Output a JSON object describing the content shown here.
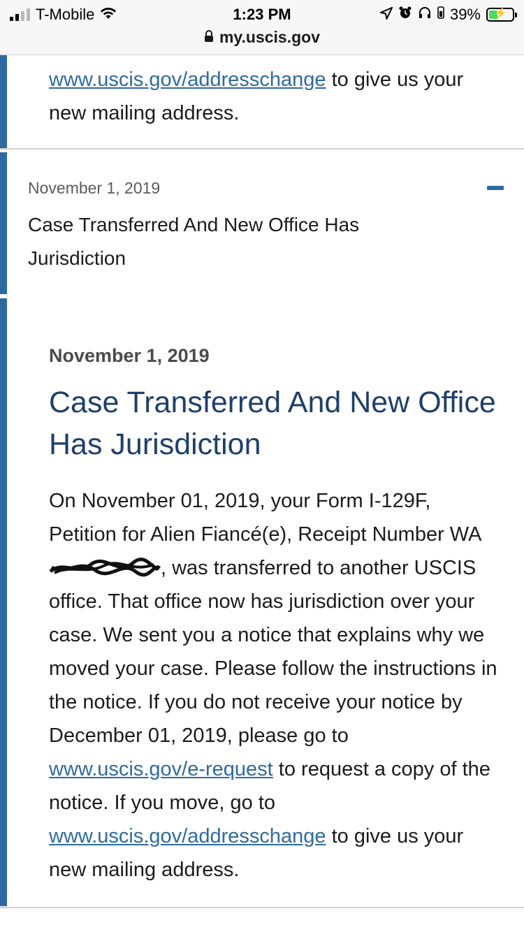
{
  "status_bar": {
    "carrier": "T-Mobile",
    "time": "1:23 PM",
    "battery": "39%",
    "battery_level": 0.39,
    "url": "my.uscis.gov"
  },
  "previous_entry": {
    "link": "www.uscis.gov/addresschange",
    "text_after_link": " to give us your new mailing address."
  },
  "collapsed_entry": {
    "date": "November 1, 2019",
    "title": "Case Transferred And New Office Has Jurisdiction"
  },
  "detail": {
    "date": "November 1, 2019",
    "title": "Case Transferred And New Office Has Jurisdiction",
    "body_part1": "On November 01, 2019, your Form I-129F, Petition for Alien Fiancé(e), Receipt Number WA",
    "body_part2": ", was transferred to another USCIS office. That office now has jurisdiction over your case. We sent you a notice that explains why we moved your case. Please follow the instructions in the notice. If you do not receive your notice by December 01, 2019, please go to ",
    "link1": "www.uscis.gov/e-request",
    "body_part3": " to request a copy of the notice. If you move, go to ",
    "link2": "www.uscis.gov/addresschange",
    "body_part4": " to give us your new mailing address."
  },
  "colors": {
    "accent": "#2e6aa1",
    "title": "#1f3f6b"
  }
}
